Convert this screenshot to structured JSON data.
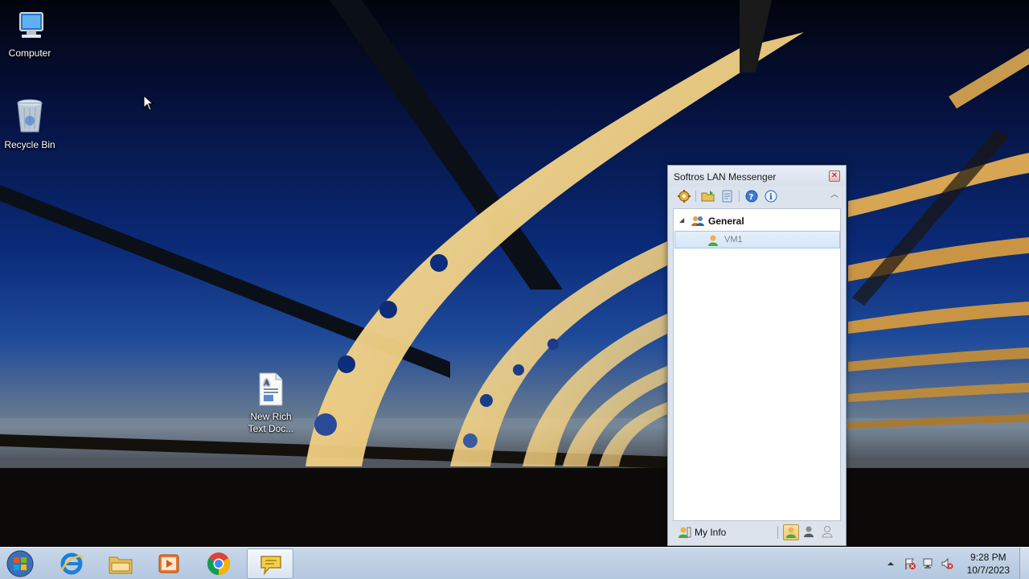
{
  "desktop": {
    "icons": [
      {
        "label": "Computer",
        "icon": "computer-icon"
      },
      {
        "label": "Recycle Bin",
        "icon": "recycle-bin-icon"
      },
      {
        "label_line1": "New Rich",
        "label_line2": "Text Doc...",
        "icon": "rich-text-document-icon"
      }
    ]
  },
  "messenger": {
    "title": "Softros LAN Messenger",
    "toolbar": [
      "settings-icon",
      "open-folder-icon",
      "history-icon",
      "help-icon",
      "info-icon",
      "collapse-icon"
    ],
    "group": {
      "name": "General",
      "expanded": true
    },
    "contacts": [
      {
        "name": "VM1",
        "status": "available"
      }
    ],
    "footer": {
      "my_info_label": "My Info",
      "statuses": [
        "available",
        "busy",
        "offline"
      ],
      "active_status": "available"
    }
  },
  "taskbar": {
    "apps": [
      "start-icon",
      "internet-explorer-icon",
      "windows-explorer-icon",
      "media-player-icon",
      "chrome-icon",
      "softros-messenger-icon"
    ],
    "active_app": "softros-messenger-icon",
    "clock": {
      "time": "9:28 PM",
      "date": "10/7/2023"
    }
  },
  "colors": {
    "taskbar": "#c1d3e8",
    "selection": "#d9e8f9",
    "window_frame": "#dce3ed"
  }
}
